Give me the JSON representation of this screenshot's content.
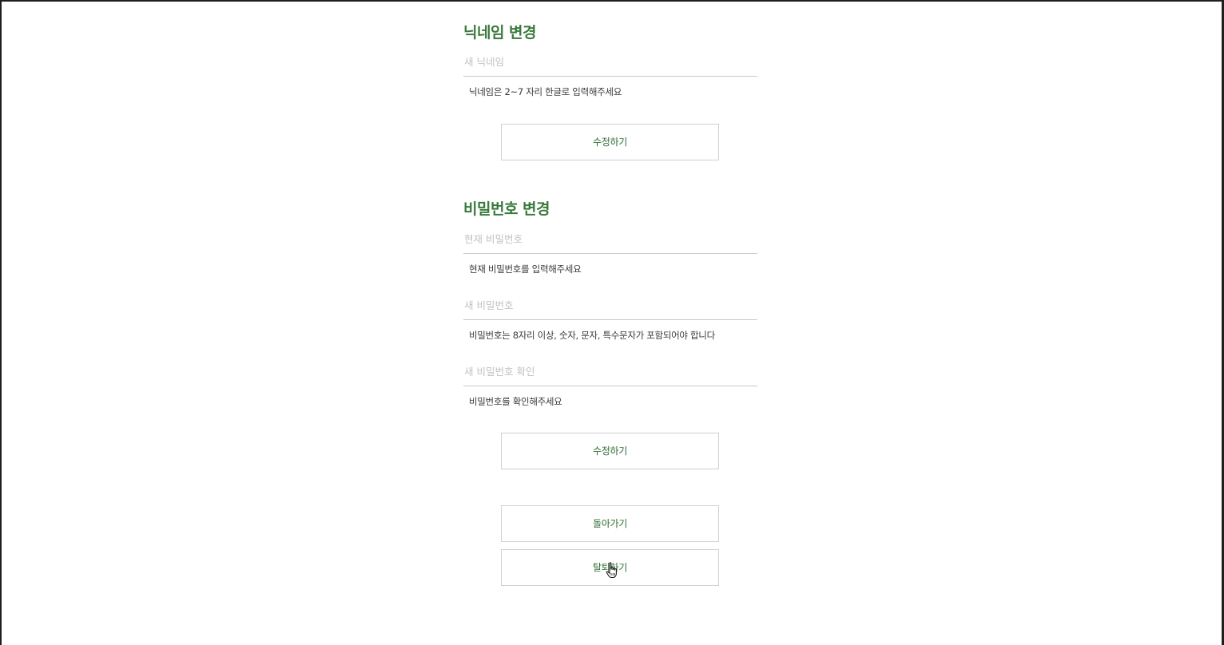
{
  "nickname_section": {
    "title": "닉네임 변경",
    "input_placeholder": "새 닉네임",
    "helper": "닉네임은 2~7 자리 한글로 입력해주세요",
    "submit_label": "수정하기"
  },
  "password_section": {
    "title": "비밀번호 변경",
    "current": {
      "placeholder": "현재 비밀번호",
      "helper": "현재 비밀번호를 입력해주세요"
    },
    "new": {
      "placeholder": "새 비밀번호",
      "helper": "비밀번호는 8자리 이상, 숫자, 문자, 특수문자가 포함되어야 합니다"
    },
    "confirm": {
      "placeholder": "새 비밀번호 확인",
      "helper": "비밀번호를 확인해주세요"
    },
    "submit_label": "수정하기"
  },
  "actions": {
    "back_label": "돌아가기",
    "withdraw_label": "탈퇴하기"
  },
  "colors": {
    "accent": "#3a7a3c",
    "button_text": "#2f6b30",
    "border": "#d0d0d0"
  },
  "icons": {
    "cursor": "hand-pointer-icon"
  }
}
